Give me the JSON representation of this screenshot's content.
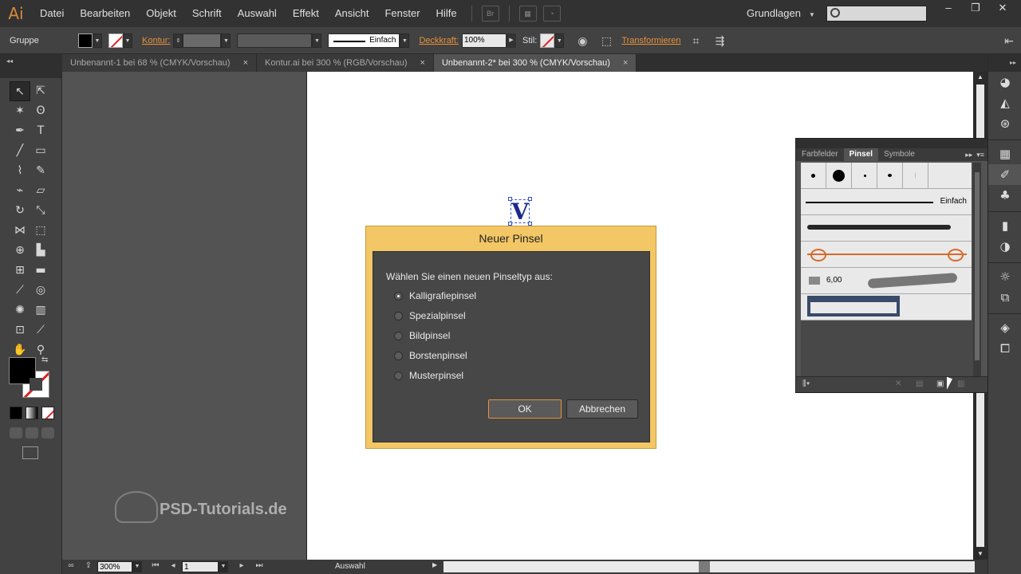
{
  "app": {
    "logo": "Ai"
  },
  "menu": [
    "Datei",
    "Bearbeiten",
    "Objekt",
    "Schrift",
    "Auswahl",
    "Effekt",
    "Ansicht",
    "Fenster",
    "Hilfe"
  ],
  "menubar": {
    "bridge_label": "Br",
    "workspace": "Grundlagen",
    "search_placeholder": ""
  },
  "window_controls": {
    "minimize": "–",
    "restore": "❐",
    "close": "✕"
  },
  "controlbar": {
    "selection_label": "Gruppe",
    "stroke_label": "Kontur:",
    "stroke_style": "Einfach",
    "opacity_label": "Deckkraft:",
    "opacity_value": "100%",
    "style_label": "Stil:",
    "transform_label": "Transformieren"
  },
  "tabs": [
    {
      "label": "Unbenannt-1 bei 68 % (CMYK/Vorschau)",
      "close": "×",
      "active": false
    },
    {
      "label": "Kontur.ai bei 300 % (RGB/Vorschau)",
      "close": "×",
      "active": false
    },
    {
      "label": "Unbenannt-2* bei 300 % (CMYK/Vorschau)",
      "close": "×",
      "active": true
    }
  ],
  "tools": [
    "selection-tool-icon",
    "direct-selection-tool-icon",
    "magic-wand-tool-icon",
    "lasso-tool-icon",
    "pen-tool-icon",
    "type-tool-icon",
    "line-tool-icon",
    "rectangle-tool-icon",
    "paintbrush-tool-icon",
    "pencil-tool-icon",
    "blob-brush-tool-icon",
    "eraser-tool-icon",
    "rotate-tool-icon",
    "scale-tool-icon",
    "width-tool-icon",
    "free-transform-tool-icon",
    "shape-builder-tool-icon",
    "perspective-grid-tool-icon",
    "mesh-tool-icon",
    "gradient-tool-icon",
    "eyedropper-tool-icon",
    "blend-tool-icon",
    "symbol-sprayer-tool-icon",
    "column-graph-tool-icon",
    "artboard-tool-icon",
    "slice-tool-icon",
    "hand-tool-icon",
    "zoom-tool-icon"
  ],
  "canvas": {
    "selected_glyph": "V"
  },
  "watermark": {
    "text": "PSD-Tutorials.de"
  },
  "statusbar": {
    "zoom": "300%",
    "page": "1",
    "status": "Auswahl"
  },
  "brush_panel": {
    "tabs": [
      "Farbfelder",
      "Pinsel",
      "Symbole"
    ],
    "active_tab": "Pinsel",
    "basic_label": "Einfach",
    "bristle_size": "6,00"
  },
  "dialog": {
    "title": "Neuer Pinsel",
    "prompt": "Wählen Sie einen neuen Pinseltyp aus:",
    "options": [
      "Kalligrafiepinsel",
      "Spezialpinsel",
      "Bildpinsel",
      "Borstenpinsel",
      "Musterpinsel"
    ],
    "selected_index": 0,
    "ok": "OK",
    "cancel": "Abbrechen"
  },
  "colors": {
    "dialog_title_bg": "#f3c766",
    "accent_orange": "#e8913a",
    "ui_dark": "#424242"
  }
}
